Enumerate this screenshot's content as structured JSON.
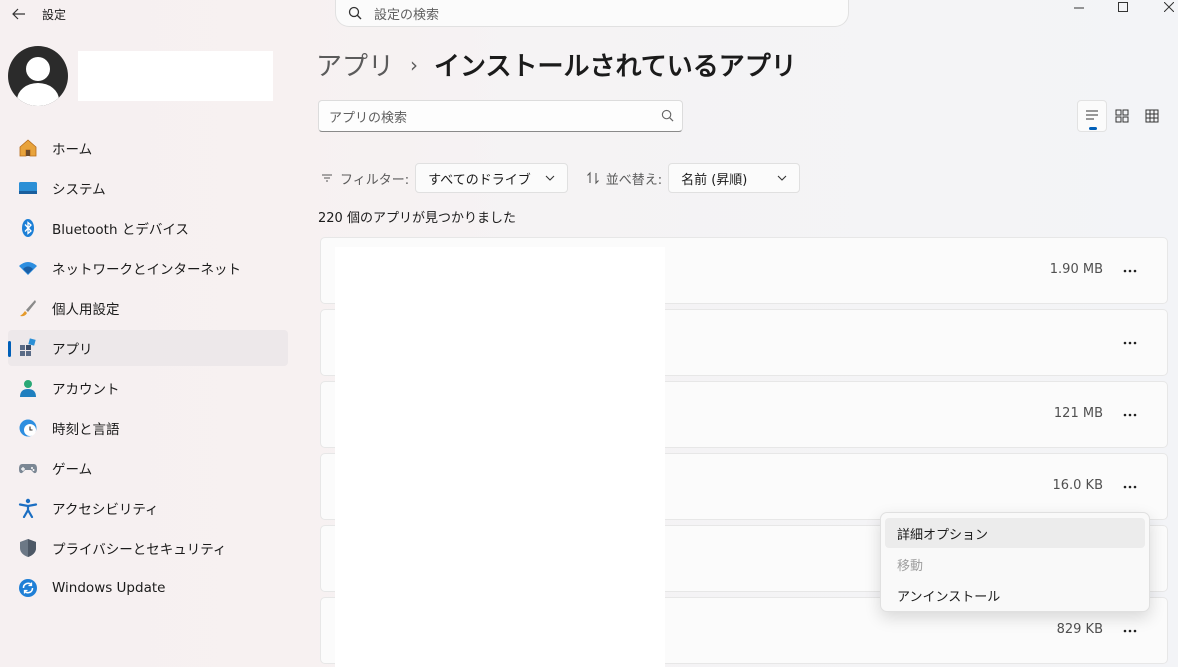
{
  "window": {
    "title": "設定",
    "search_placeholder": "設定の検索",
    "controls": [
      "minimize-icon",
      "maximize-icon",
      "close-icon"
    ]
  },
  "sidebar": {
    "items": [
      {
        "label": "ホーム",
        "icon": "home-icon"
      },
      {
        "label": "システム",
        "icon": "system-icon"
      },
      {
        "label": "Bluetooth とデバイス",
        "icon": "bluetooth-icon"
      },
      {
        "label": "ネットワークとインターネット",
        "icon": "wifi-icon"
      },
      {
        "label": "個人用設定",
        "icon": "brush-icon"
      },
      {
        "label": "アプリ",
        "icon": "apps-icon",
        "selected": true
      },
      {
        "label": "アカウント",
        "icon": "account-icon"
      },
      {
        "label": "時刻と言語",
        "icon": "time-language-icon"
      },
      {
        "label": "ゲーム",
        "icon": "gamepad-icon"
      },
      {
        "label": "アクセシビリティ",
        "icon": "accessibility-icon"
      },
      {
        "label": "プライバシーとセキュリティ",
        "icon": "shield-icon"
      },
      {
        "label": "Windows Update",
        "icon": "update-icon"
      }
    ]
  },
  "main": {
    "breadcrumb_parent": "アプリ",
    "breadcrumb_separator": "›",
    "breadcrumb_current": "インストールされているアプリ",
    "app_search_placeholder": "アプリの検索",
    "filter_label": "フィルター:",
    "filter_value": "すべてのドライブ",
    "sort_label": "並べ替え:",
    "sort_value": "名前 (昇順)",
    "count_text": "220 個のアプリが見つかりました",
    "apps": [
      {
        "size": "1.90 MB"
      },
      {
        "size": ""
      },
      {
        "size": "121 MB"
      },
      {
        "size": "16.0 KB"
      },
      {
        "size": ""
      },
      {
        "size": "829 KB"
      }
    ]
  },
  "context_menu": {
    "items": [
      {
        "label": "詳細オプション",
        "enabled": true
      },
      {
        "label": "移動",
        "enabled": false
      },
      {
        "label": "アンインストール",
        "enabled": true
      }
    ]
  },
  "colors": {
    "accent": "#005fb8"
  }
}
